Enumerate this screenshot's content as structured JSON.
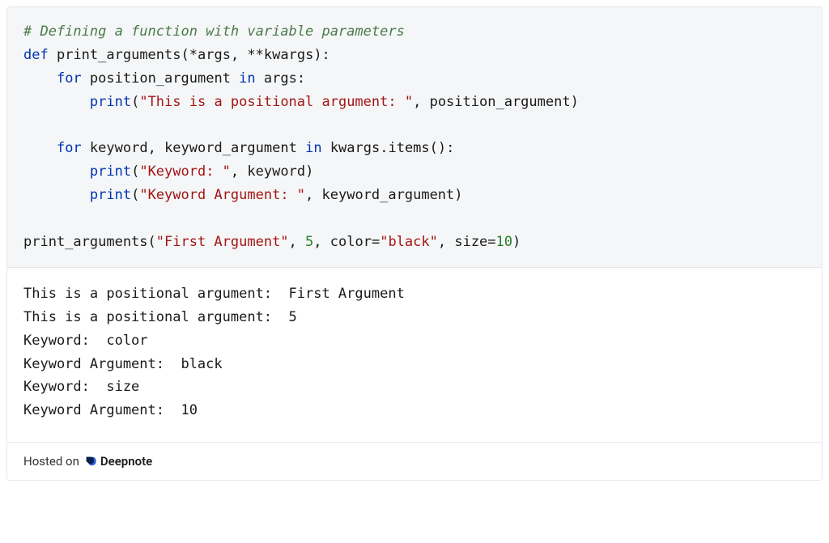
{
  "code": {
    "comment": "# Defining a function with variable parameters",
    "kw_def": "def",
    "func_name": "print_arguments",
    "sig_open": "(*",
    "p_args": "args",
    "sig_mid": ", **",
    "p_kwargs": "kwargs",
    "sig_close": "):",
    "indent1": "    ",
    "indent2": "        ",
    "kw_for1": "for",
    "var_pos": "position_argument",
    "kw_in1": "in",
    "iter1": "args",
    "colon1": ":",
    "builtin_print1": "print",
    "open_paren1": "(",
    "str1": "\"This is a positional argument: \"",
    "comma1": ", ",
    "arg1": "position_argument",
    "close_paren1": ")",
    "kw_for2": "for",
    "var_kw": "keyword",
    "comma_unpack": ", ",
    "var_kwarg": "keyword_argument",
    "kw_in2": "in",
    "iter2_base": "kwargs",
    "iter2_method": ".items()",
    "colon2": ":",
    "builtin_print2": "print",
    "open_paren2": "(",
    "str2": "\"Keyword: \"",
    "comma2": ", ",
    "arg2": "keyword",
    "close_paren2": ")",
    "builtin_print3": "print",
    "open_paren3": "(",
    "str3": "\"Keyword Argument: \"",
    "comma3": ", ",
    "arg3": "keyword_argument",
    "close_paren3": ")",
    "call_func": "print_arguments",
    "call_open": "(",
    "call_str1": "\"First Argument\"",
    "call_c1": ", ",
    "call_num1": "5",
    "call_c2": ", ",
    "call_kw1": "color",
    "call_eq1": "=",
    "call_val1": "\"black\"",
    "call_c3": ", ",
    "call_kw2": "size",
    "call_eq2": "=",
    "call_val2": "10",
    "call_close": ")"
  },
  "output": {
    "line1": "This is a positional argument:  First Argument",
    "line2": "This is a positional argument:  5",
    "line3": "Keyword:  color",
    "line4": "Keyword Argument:  black",
    "line5": "Keyword:  size",
    "line6": "Keyword Argument:  10"
  },
  "footer": {
    "hosted_on": "Hosted on",
    "brand": "Deepnote"
  }
}
